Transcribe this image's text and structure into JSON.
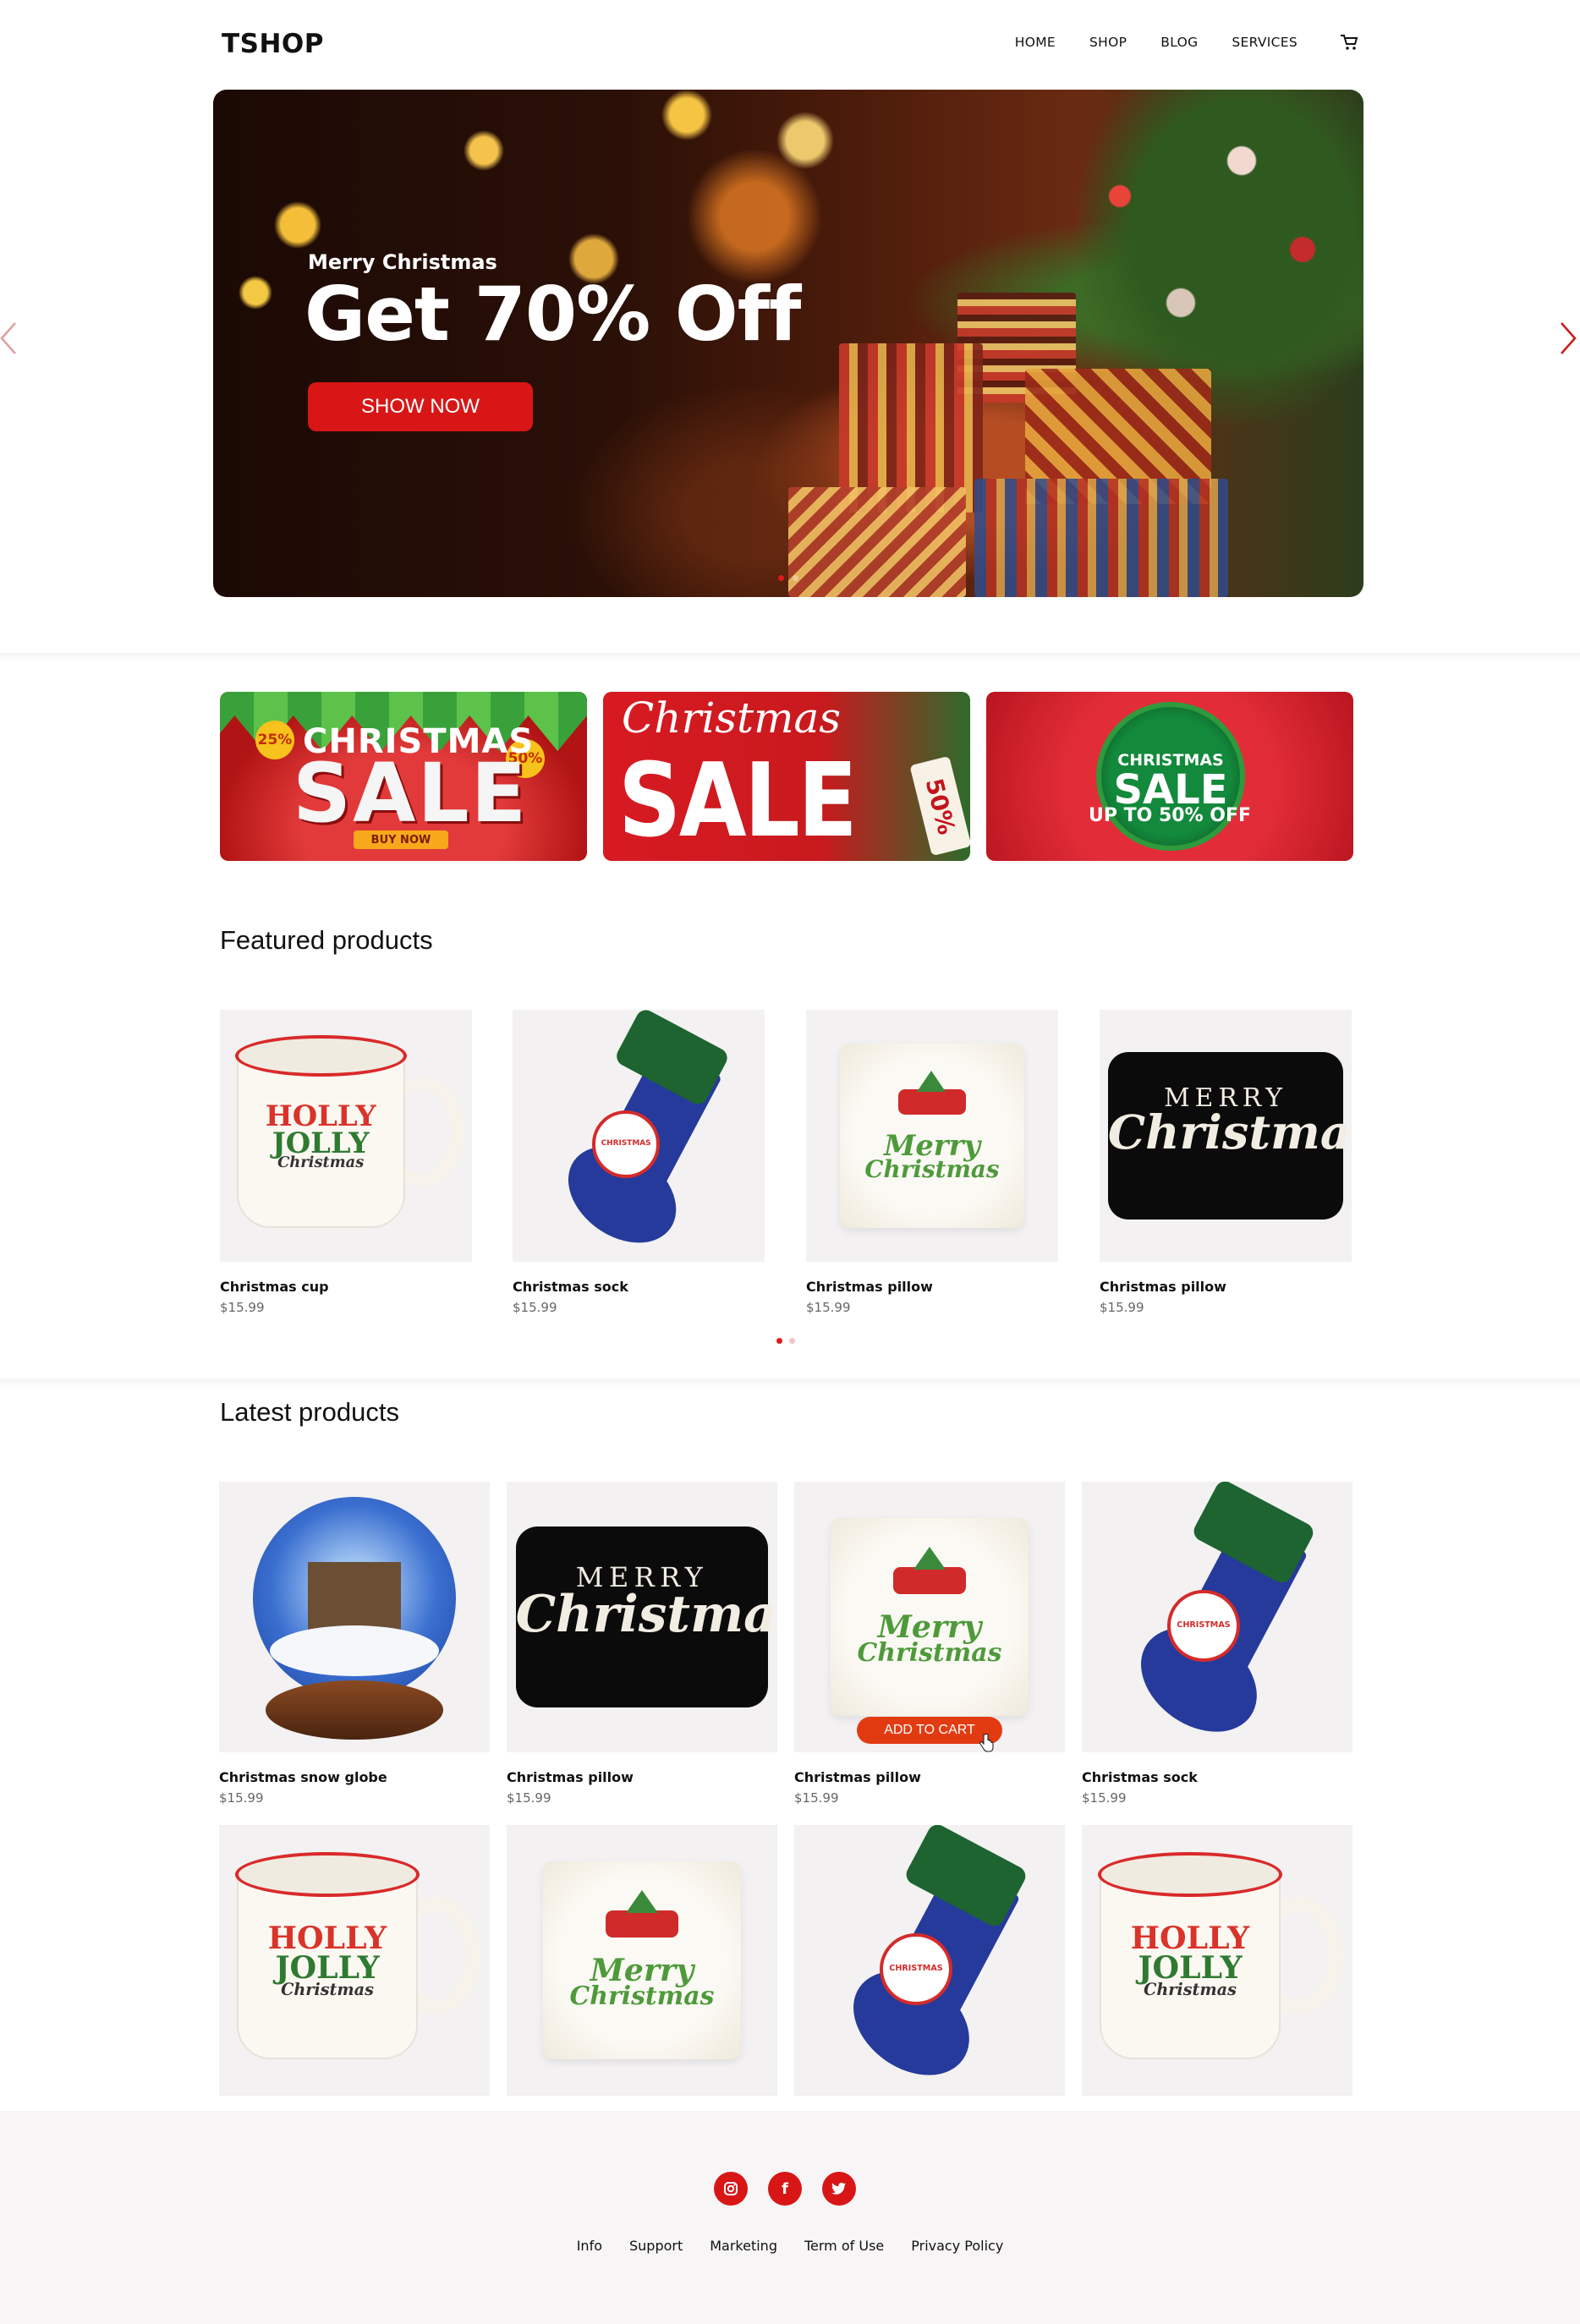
{
  "header": {
    "logo": "TSHOP",
    "nav": [
      "HOME",
      "SHOP",
      "BLOG",
      "SERVICES"
    ],
    "cart_icon": "cart-icon"
  },
  "hero": {
    "subtitle": "Merry Christmas",
    "title": "Get 70% Off",
    "button": "SHOW NOW",
    "dots": 2,
    "active_dot": 0
  },
  "banners": [
    {
      "small": "CHRISTMAS",
      "big": "SALE",
      "button": "BUY NOW",
      "badge_left": "25%",
      "badge_right": "50%"
    },
    {
      "script": "Christmas",
      "big": "SALE",
      "tag": "50%"
    },
    {
      "line1": "CHRISTMAS",
      "line2": "SALE",
      "line3": "UP TO 50% OFF"
    }
  ],
  "featured": {
    "title": "Featured products",
    "products": [
      {
        "name": "Christmas cup",
        "price": "$15.99",
        "kind": "mug"
      },
      {
        "name": "Christmas sock",
        "price": "$15.99",
        "kind": "sock"
      },
      {
        "name": "Christmas pillow",
        "price": "$15.99",
        "kind": "pillow-white"
      },
      {
        "name": "Christmas pillow",
        "price": "$15.99",
        "kind": "pillow-black"
      }
    ],
    "dots": 2,
    "active_dot": 0
  },
  "latest": {
    "title": "Latest products",
    "add_to_cart": "ADD TO CART",
    "products": [
      {
        "name": "Christmas snow globe",
        "price": "$15.99",
        "kind": "globe"
      },
      {
        "name": "Christmas pillow",
        "price": "$15.99",
        "kind": "pillow-black"
      },
      {
        "name": "Christmas pillow",
        "price": "$15.99",
        "kind": "pillow-white"
      },
      {
        "name": "Christmas sock",
        "price": "$15.99",
        "kind": "sock"
      },
      {
        "name": "",
        "price": "",
        "kind": "mug"
      },
      {
        "name": "",
        "price": "",
        "kind": "pillow-white"
      },
      {
        "name": "",
        "price": "",
        "kind": "sock"
      },
      {
        "name": "",
        "price": "",
        "kind": "mug"
      }
    ]
  },
  "footer": {
    "socials": [
      "instagram-icon",
      "facebook-icon",
      "twitter-icon"
    ],
    "links": [
      "Info",
      "Support",
      "Marketing",
      "Term of Use",
      "Privacy Policy"
    ]
  },
  "colors": {
    "accent": "#d81616",
    "cart_button": "#e23b12",
    "card_bg": "#f3f1f2",
    "footer_bg": "#f7f5f6"
  },
  "mug_text": [
    "HOLLY",
    "JOLLY",
    "Christmas"
  ],
  "pillow_black_text": [
    "MERRY",
    "Christmas"
  ],
  "pillow_white_text": [
    "Merry",
    "Christmas"
  ],
  "sock_badge_text": "CHRISTMAS"
}
